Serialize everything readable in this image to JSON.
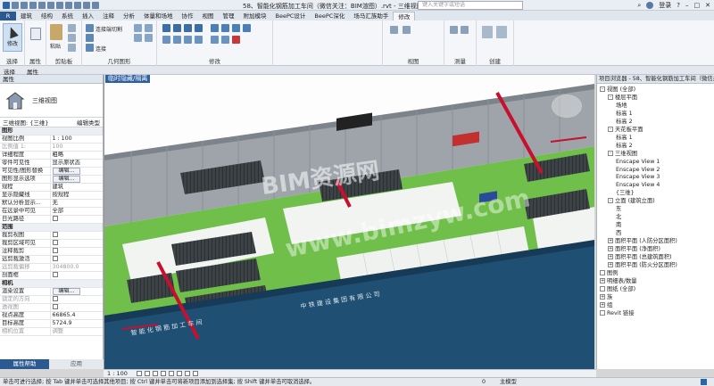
{
  "titlebar": {
    "title": "58、智能化钢筋加工车间（微信关注：BIM渲图）.rvt - 三维视图: {三维}",
    "search_placeholder": "键入关键字或短语",
    "login": "登录"
  },
  "menu": {
    "app_button": "R",
    "tabs": [
      "建筑",
      "结构",
      "系统",
      "插入",
      "注释",
      "分析",
      "体量和场地",
      "协作",
      "视图",
      "管理",
      "附加模块",
      "BeePC设计",
      "BeePC深化",
      "场马汇族助手",
      "修改"
    ],
    "active_tab": "修改"
  },
  "ribbon": {
    "groups": {
      "select": "选择",
      "properties": "属性",
      "clipboard": "剪贴板",
      "geometry": "几何图形",
      "modify": "修改",
      "view": "视图",
      "measure": "测量",
      "create": "创建"
    },
    "modify_button": "修改",
    "paste": "粘贴",
    "cut": "连接端切割",
    "join": "连接",
    "properties_btn": "属性"
  },
  "properties_panel": {
    "title": "属性",
    "type_name": "三维视图",
    "filter_value": "三维视图: {三维}",
    "edit_type": "编辑类型",
    "rows": [
      {
        "k": "图形",
        "v": "",
        "section": true
      },
      {
        "k": "视图比例",
        "v": "1 : 100"
      },
      {
        "k": "比例值 1:",
        "v": "100",
        "disabled": true
      },
      {
        "k": "详细程度",
        "v": "粗略"
      },
      {
        "k": "零件可见性",
        "v": "显示原状态"
      },
      {
        "k": "可见性/图形替换",
        "v": "编辑...",
        "button": true
      },
      {
        "k": "图形显示选项",
        "v": "编辑...",
        "button": true
      },
      {
        "k": "规程",
        "v": "建筑"
      },
      {
        "k": "显示隐藏线",
        "v": "按规程"
      },
      {
        "k": "默认分析显示...",
        "v": "无"
      },
      {
        "k": "在远景中可见",
        "v": "全部"
      },
      {
        "k": "日光路径",
        "v": "",
        "check": true
      },
      {
        "k": "范围",
        "v": "",
        "section": true
      },
      {
        "k": "裁剪视图",
        "v": "",
        "check": true
      },
      {
        "k": "裁剪区域可见",
        "v": "",
        "check": true
      },
      {
        "k": "注释裁剪",
        "v": "",
        "check": true
      },
      {
        "k": "远剪裁激活",
        "v": "",
        "check": true
      },
      {
        "k": "远剪裁偏移",
        "v": "304800.0",
        "disabled": true
      },
      {
        "k": "剖面框",
        "v": "",
        "check": true
      },
      {
        "k": "相机",
        "v": "",
        "section": true
      },
      {
        "k": "渲染设置",
        "v": "编辑...",
        "button": true
      },
      {
        "k": "锁定的方向",
        "v": "",
        "check": true,
        "disabled": true
      },
      {
        "k": "透视图",
        "v": "",
        "check": true,
        "disabled": true
      },
      {
        "k": "视点高度",
        "v": "66865.4"
      },
      {
        "k": "目标高度",
        "v": "5724.9"
      },
      {
        "k": "相机位置",
        "v": "调整",
        "disabled": true
      }
    ],
    "footer_help": "属性帮助",
    "footer_apply": "应用"
  },
  "viewport": {
    "tab_label": "临时隐藏/隔离",
    "watermark": "BIM资源网",
    "watermark_url": "www.bimzyw.com",
    "scale": "1 : 100"
  },
  "browser": {
    "title": "项目浏览器 - 58、智能化钢筋加工车间（微信关注...",
    "items": [
      {
        "label": "视图 (全部)",
        "level": 0,
        "toggle": "-"
      },
      {
        "label": "楼层平面",
        "level": 1,
        "toggle": "-"
      },
      {
        "label": "场地",
        "level": 2
      },
      {
        "label": "标高 1",
        "level": 2
      },
      {
        "label": "标高 2",
        "level": 2
      },
      {
        "label": "天花板平面",
        "level": 1,
        "toggle": "-"
      },
      {
        "label": "标高 1",
        "level": 2
      },
      {
        "label": "标高 2",
        "level": 2
      },
      {
        "label": "三维视图",
        "level": 1,
        "toggle": "-"
      },
      {
        "label": "Enscape View 1",
        "level": 2
      },
      {
        "label": "Enscape View 2",
        "level": 2
      },
      {
        "label": "Enscape View 3",
        "level": 2
      },
      {
        "label": "Enscape View 4",
        "level": 2
      },
      {
        "label": "{三维}",
        "level": 2
      },
      {
        "label": "立面 (建筑立面)",
        "level": 1,
        "toggle": "-"
      },
      {
        "label": "东",
        "level": 2
      },
      {
        "label": "北",
        "level": 2
      },
      {
        "label": "南",
        "level": 2
      },
      {
        "label": "西",
        "level": 2
      },
      {
        "label": "面积平面 (人防分区面积)",
        "level": 1,
        "toggle": "+"
      },
      {
        "label": "面积平面 (净面积)",
        "level": 1,
        "toggle": "+"
      },
      {
        "label": "面积平面 (总建筑面积)",
        "level": 1,
        "toggle": "+"
      },
      {
        "label": "面积平面 (防火分区面积)",
        "level": 1,
        "toggle": "+"
      },
      {
        "label": "图例",
        "level": 0,
        "toggle": ""
      },
      {
        "label": "明细表/数量",
        "level": 0,
        "toggle": "+"
      },
      {
        "label": "图纸 (全部)",
        "level": 0,
        "toggle": ""
      },
      {
        "label": "族",
        "level": 0,
        "toggle": "+"
      },
      {
        "label": "组",
        "level": 0,
        "toggle": "+"
      },
      {
        "label": "Revit 链接",
        "level": 0,
        "toggle": ""
      }
    ]
  },
  "statusbar": {
    "text": "单击可进行选择; 按 Tab 键并单击可选择其他项目; 按 Ctrl 键并单击可将新项目添加到选择集; 按 Shift 键并单击可取消选择。",
    "model": "主模型",
    "zero": "0"
  },
  "colors": {
    "accent": "#2b5a93",
    "steel_red": "#c8102e",
    "floor_green": "#6fbf4a",
    "wall_blue": "#1f4f72"
  }
}
